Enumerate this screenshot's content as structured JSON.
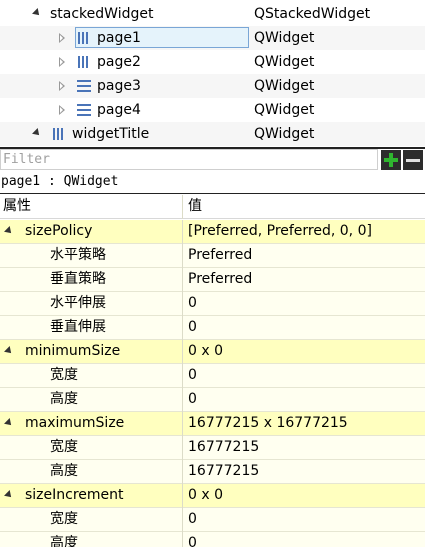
{
  "object_tree": {
    "rows": [
      {
        "name": "stackedWidget",
        "class": "QStackedWidget"
      },
      {
        "name": "page1",
        "class": "QWidget"
      },
      {
        "name": "page2",
        "class": "QWidget"
      },
      {
        "name": "page3",
        "class": "QWidget"
      },
      {
        "name": "page4",
        "class": "QWidget"
      },
      {
        "name": "widgetTitle",
        "class": "QWidget"
      }
    ]
  },
  "filter": {
    "placeholder": "Filter"
  },
  "object_label": "page1 : QWidget",
  "property_table": {
    "header": {
      "name": "属性",
      "value": "值"
    },
    "rows": [
      {
        "name": "sizePolicy",
        "value": "[Preferred, Preferred, 0, 0]"
      },
      {
        "name": "水平策略",
        "value": "Preferred"
      },
      {
        "name": "垂直策略",
        "value": "Preferred"
      },
      {
        "name": "水平伸展",
        "value": "0"
      },
      {
        "name": "垂直伸展",
        "value": "0"
      },
      {
        "name": "minimumSize",
        "value": "0 x 0"
      },
      {
        "name": "宽度",
        "value": "0"
      },
      {
        "name": "高度",
        "value": "0"
      },
      {
        "name": "maximumSize",
        "value": "16777215 x 16777215"
      },
      {
        "name": "宽度",
        "value": "16777215"
      },
      {
        "name": "高度",
        "value": "16777215"
      },
      {
        "name": "sizeIncrement",
        "value": "0 x 0"
      },
      {
        "name": "宽度",
        "value": "0"
      },
      {
        "name": "高度",
        "value": "0"
      }
    ]
  },
  "colors": {
    "group_row": "#ffffbf",
    "sub_row": "#fffff0",
    "selection": "#e5f3fb",
    "icon": "#4a74b8",
    "add_icon": "#2fb52f"
  }
}
